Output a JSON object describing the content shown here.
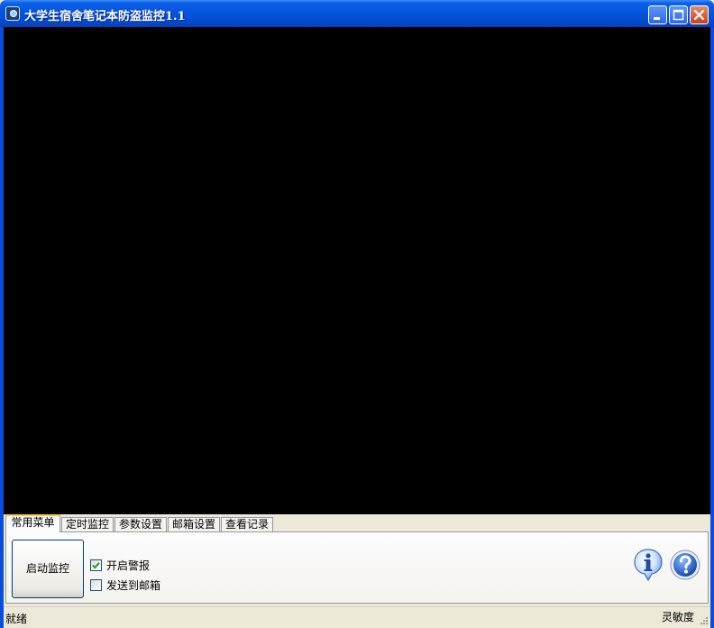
{
  "window": {
    "title": "大学生宿舍笔记本防盗监控1.1",
    "icon": "camera-app-icon",
    "controls": [
      "minimize-icon",
      "maximize-icon",
      "close-icon"
    ]
  },
  "tabs": [
    {
      "label": "常用菜单",
      "active": true
    },
    {
      "label": "定时监控",
      "active": false
    },
    {
      "label": "参数设置",
      "active": false
    },
    {
      "label": "邮箱设置",
      "active": false
    },
    {
      "label": "查看记录",
      "active": false
    }
  ],
  "panel": {
    "start_button": "启动监控",
    "alarm_checkbox": {
      "label": "开启警报",
      "checked": true
    },
    "email_checkbox": {
      "label": "发送到邮箱",
      "checked": false
    },
    "icons": [
      "info-icon",
      "help-icon"
    ]
  },
  "status": {
    "left": "就绪",
    "right": "灵敏度"
  },
  "colors": {
    "video_background": "#000000",
    "titlebar": "#0553dd",
    "active_tab_accent": "#ffc83c"
  }
}
